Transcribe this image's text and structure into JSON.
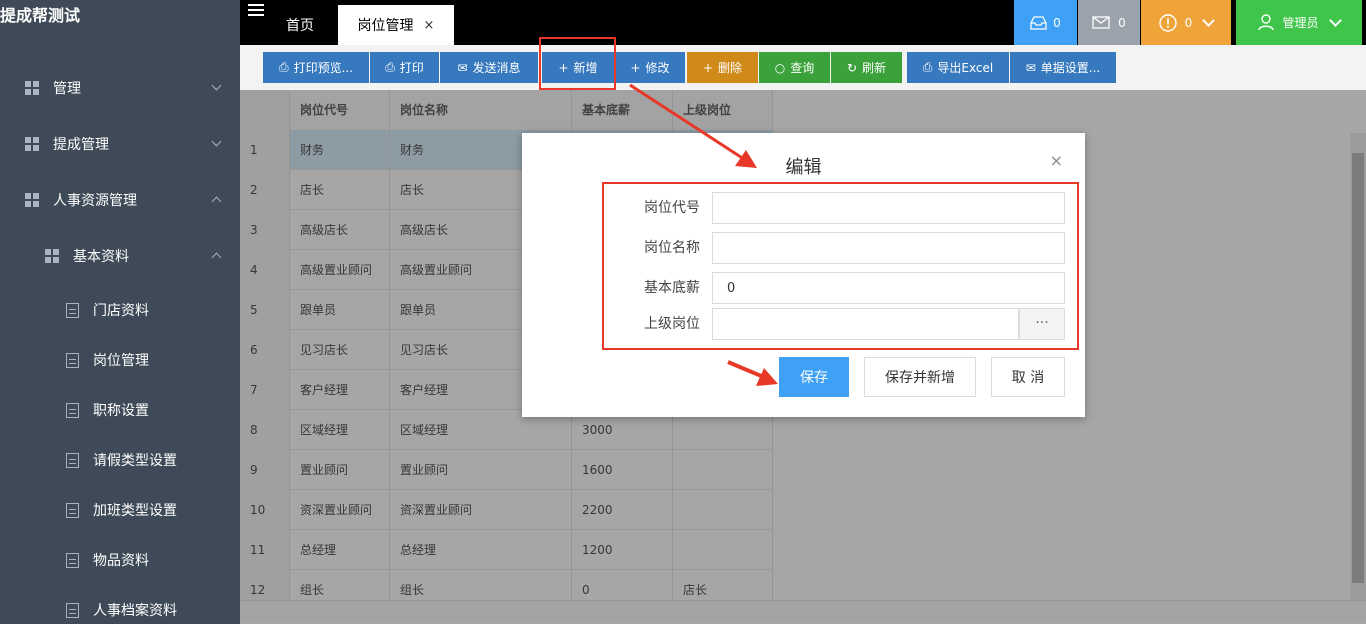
{
  "sidebar": {
    "brand": "提成帮测试",
    "menus": [
      {
        "label": "管理"
      },
      {
        "label": "提成管理"
      },
      {
        "label": "人事资源管理"
      }
    ],
    "submenu": {
      "label": "基本资料"
    },
    "items": [
      {
        "label": "门店资料"
      },
      {
        "label": "岗位管理"
      },
      {
        "label": "职称设置"
      },
      {
        "label": "请假类型设置"
      },
      {
        "label": "加班类型设置"
      },
      {
        "label": "物品资料"
      },
      {
        "label": "人事档案资料"
      }
    ]
  },
  "topbar": {
    "tabs": [
      {
        "label": "首页"
      },
      {
        "label": "岗位管理",
        "close": "×"
      }
    ],
    "inbox_count": "0",
    "mail_count": "0",
    "alert_count": "0",
    "user_label": "管理员"
  },
  "toolbar": {
    "buttons": [
      {
        "label": "打印预览...",
        "icon": "printer-icon",
        "glyph": "⎙"
      },
      {
        "label": "打印",
        "icon": "printer-icon",
        "glyph": "⎙"
      },
      {
        "label": "发送消息",
        "icon": "mail-icon",
        "glyph": "✉"
      },
      {
        "label": "新增",
        "icon": "plus-icon",
        "glyph": "+"
      },
      {
        "label": "修改",
        "icon": "plus-icon",
        "glyph": "+"
      },
      {
        "label": "删除",
        "icon": "plus-icon",
        "glyph": "+"
      },
      {
        "label": "查询",
        "icon": "search-icon",
        "glyph": "○"
      },
      {
        "label": "刷新",
        "icon": "refresh-icon",
        "glyph": "↻"
      },
      {
        "label": "导出Excel",
        "icon": "printer-icon",
        "glyph": "⎙"
      },
      {
        "label": "单据设置...",
        "icon": "mail-icon",
        "glyph": "✉"
      }
    ],
    "colors": {
      "blue": "#3779bf",
      "orange": "#cf8a19",
      "green": "#3ba13b"
    }
  },
  "table": {
    "columns": [
      "岗位代号",
      "岗位名称",
      "基本底薪",
      "上级岗位"
    ],
    "rows": [
      {
        "n": "1",
        "code": "财务",
        "name": "财务",
        "salary": "",
        "parent": ""
      },
      {
        "n": "2",
        "code": "店长",
        "name": "店长",
        "salary": "",
        "parent": ""
      },
      {
        "n": "3",
        "code": "高级店长",
        "name": "高级店长",
        "salary": "",
        "parent": ""
      },
      {
        "n": "4",
        "code": "高级置业顾问",
        "name": "高级置业顾问",
        "salary": "",
        "parent": ""
      },
      {
        "n": "5",
        "code": "跟单员",
        "name": "跟单员",
        "salary": "",
        "parent": ""
      },
      {
        "n": "6",
        "code": "见习店长",
        "name": "见习店长",
        "salary": "",
        "parent": ""
      },
      {
        "n": "7",
        "code": "客户经理",
        "name": "客户经理",
        "salary": "",
        "parent": ""
      },
      {
        "n": "8",
        "code": "区域经理",
        "name": "区域经理",
        "salary": "3000",
        "parent": ""
      },
      {
        "n": "9",
        "code": "置业顾问",
        "name": "置业顾问",
        "salary": "1600",
        "parent": ""
      },
      {
        "n": "10",
        "code": "资深置业顾问",
        "name": "资深置业顾问",
        "salary": "2200",
        "parent": ""
      },
      {
        "n": "11",
        "code": "总经理",
        "name": "总经理",
        "salary": "1200",
        "parent": ""
      },
      {
        "n": "12",
        "code": "组长",
        "name": "组长",
        "salary": "0",
        "parent": "店长"
      }
    ]
  },
  "dialog": {
    "title": "编辑",
    "close": "×",
    "fields": [
      {
        "label": "岗位代号",
        "value": ""
      },
      {
        "label": "岗位名称",
        "value": ""
      },
      {
        "label": "基本底薪",
        "value": "0"
      },
      {
        "label": "上级岗位",
        "value": "",
        "picker": "···"
      }
    ],
    "save_label": "保存",
    "save_new_label": "保存并新增",
    "cancel_label": "取 消"
  },
  "annotation_color": "#e83828"
}
